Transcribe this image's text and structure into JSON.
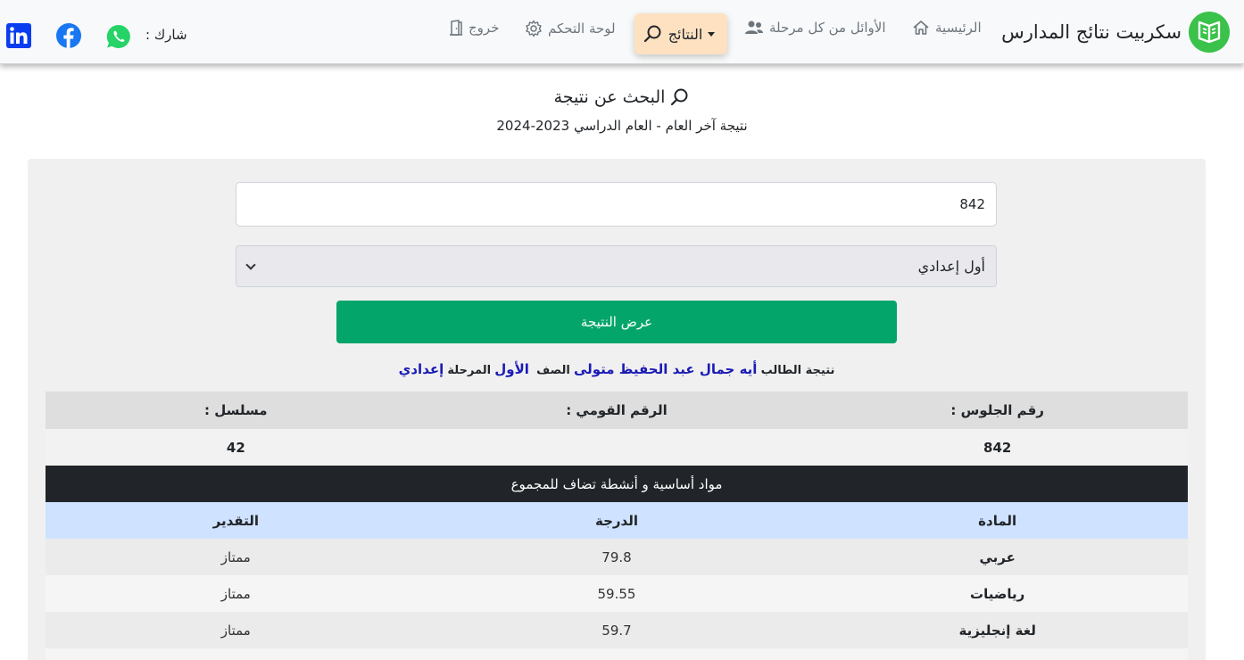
{
  "brand": {
    "title": "سكربيت نتائج المدارس"
  },
  "nav": {
    "home": "الرئيسية",
    "top_students": "الأوائل من كل مرحلة",
    "results": "النتائج",
    "dashboard": "لوحة التحكم",
    "logout": "خروج"
  },
  "share": {
    "label": "شارك :"
  },
  "search": {
    "title": "البحث عن نتيجة",
    "subtitle": "نتيجة آخر العام - العام الدراسي 2023-2024"
  },
  "form": {
    "seat_number_value": "842",
    "grade_selected": "أول إعدادي",
    "submit_label": "عرض النتيجة"
  },
  "student": {
    "prefix": "نتيجة الطالب",
    "name": "أيه جمال عبد الحفيظ متولى",
    "grade_label": "الصف",
    "grade": "الأول",
    "stage_label": "المرحلة",
    "stage": "إعدادي"
  },
  "info": {
    "headers": [
      "رقم الجلوس :",
      "الرقم القومي :",
      "مسلسل :"
    ],
    "values": [
      "842",
      "",
      "42"
    ]
  },
  "subjects": {
    "section_title": "مواد أساسية و أنشطة تضاف للمجموع",
    "headers": [
      "المادة",
      "الدرجة",
      "التقدير"
    ],
    "rows": [
      [
        "عربي",
        "79.8",
        "ممتاز"
      ],
      [
        "رياضيات",
        "59.55",
        "ممتاز"
      ],
      [
        "لغة إنجليزية",
        "59.7",
        "ممتاز"
      ]
    ]
  },
  "colors": {
    "brand_green": "#3ac24a",
    "active_nav_bg": "#fde1c1",
    "submit_green": "#04a56b",
    "student_highlight": "#1a1ab5",
    "subject_header_bg": "#cfe2ff",
    "dark_row_bg": "#212529",
    "whatsapp": "#25d366",
    "facebook": "#1877f2",
    "linkedin": "#0a3cf0"
  },
  "icons": {
    "brand": "book-open-icon",
    "home": "home-icon",
    "top_students": "users-icon",
    "results": "search-icon",
    "dashboard": "gear-icon",
    "logout": "door-icon",
    "social": [
      "whatsapp-icon",
      "facebook-icon",
      "linkedin-icon"
    ]
  }
}
